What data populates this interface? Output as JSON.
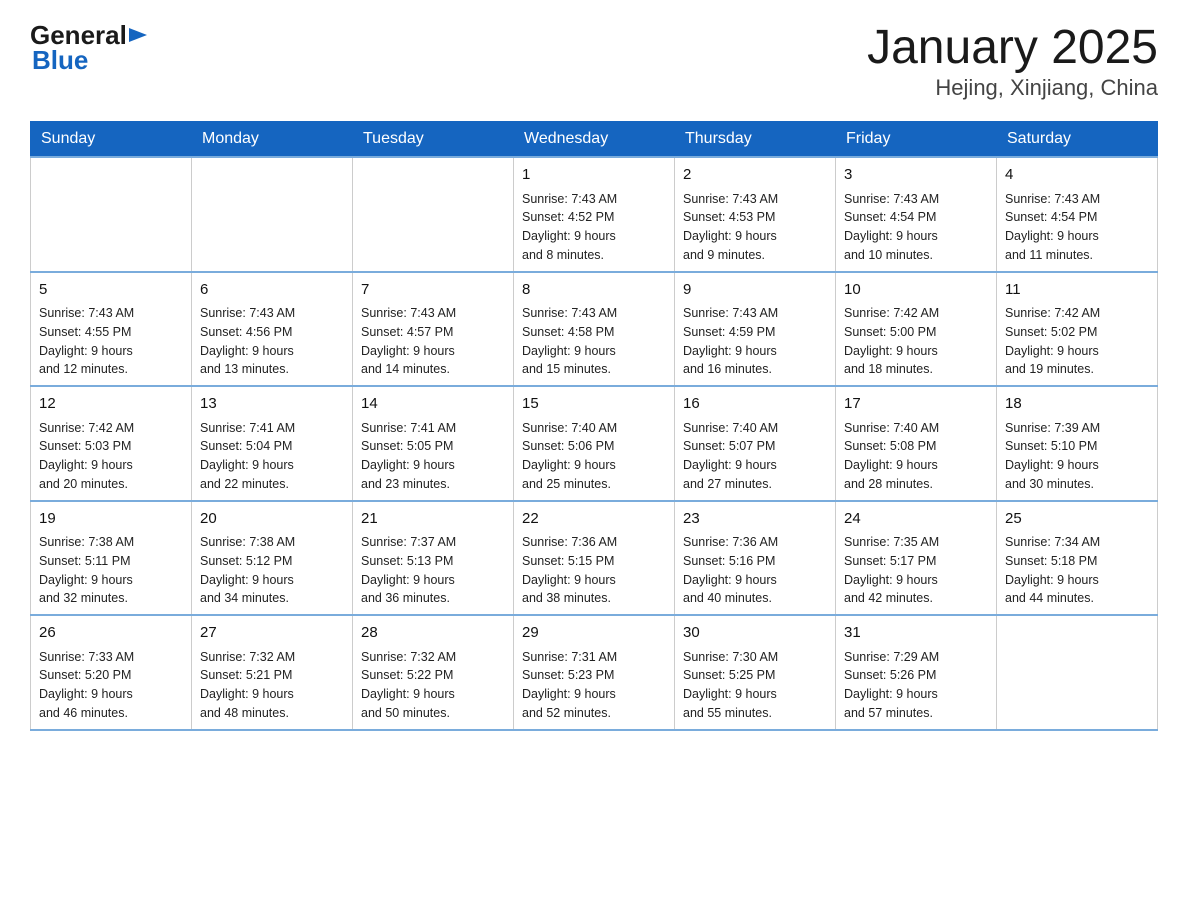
{
  "header": {
    "logo": {
      "general": "General",
      "blue": "Blue"
    },
    "title": "January 2025",
    "subtitle": "Hejing, Xinjiang, China"
  },
  "calendar": {
    "weekdays": [
      "Sunday",
      "Monday",
      "Tuesday",
      "Wednesday",
      "Thursday",
      "Friday",
      "Saturday"
    ],
    "weeks": [
      [
        {
          "day": "",
          "info": ""
        },
        {
          "day": "",
          "info": ""
        },
        {
          "day": "",
          "info": ""
        },
        {
          "day": "1",
          "info": "Sunrise: 7:43 AM\nSunset: 4:52 PM\nDaylight: 9 hours\nand 8 minutes."
        },
        {
          "day": "2",
          "info": "Sunrise: 7:43 AM\nSunset: 4:53 PM\nDaylight: 9 hours\nand 9 minutes."
        },
        {
          "day": "3",
          "info": "Sunrise: 7:43 AM\nSunset: 4:54 PM\nDaylight: 9 hours\nand 10 minutes."
        },
        {
          "day": "4",
          "info": "Sunrise: 7:43 AM\nSunset: 4:54 PM\nDaylight: 9 hours\nand 11 minutes."
        }
      ],
      [
        {
          "day": "5",
          "info": "Sunrise: 7:43 AM\nSunset: 4:55 PM\nDaylight: 9 hours\nand 12 minutes."
        },
        {
          "day": "6",
          "info": "Sunrise: 7:43 AM\nSunset: 4:56 PM\nDaylight: 9 hours\nand 13 minutes."
        },
        {
          "day": "7",
          "info": "Sunrise: 7:43 AM\nSunset: 4:57 PM\nDaylight: 9 hours\nand 14 minutes."
        },
        {
          "day": "8",
          "info": "Sunrise: 7:43 AM\nSunset: 4:58 PM\nDaylight: 9 hours\nand 15 minutes."
        },
        {
          "day": "9",
          "info": "Sunrise: 7:43 AM\nSunset: 4:59 PM\nDaylight: 9 hours\nand 16 minutes."
        },
        {
          "day": "10",
          "info": "Sunrise: 7:42 AM\nSunset: 5:00 PM\nDaylight: 9 hours\nand 18 minutes."
        },
        {
          "day": "11",
          "info": "Sunrise: 7:42 AM\nSunset: 5:02 PM\nDaylight: 9 hours\nand 19 minutes."
        }
      ],
      [
        {
          "day": "12",
          "info": "Sunrise: 7:42 AM\nSunset: 5:03 PM\nDaylight: 9 hours\nand 20 minutes."
        },
        {
          "day": "13",
          "info": "Sunrise: 7:41 AM\nSunset: 5:04 PM\nDaylight: 9 hours\nand 22 minutes."
        },
        {
          "day": "14",
          "info": "Sunrise: 7:41 AM\nSunset: 5:05 PM\nDaylight: 9 hours\nand 23 minutes."
        },
        {
          "day": "15",
          "info": "Sunrise: 7:40 AM\nSunset: 5:06 PM\nDaylight: 9 hours\nand 25 minutes."
        },
        {
          "day": "16",
          "info": "Sunrise: 7:40 AM\nSunset: 5:07 PM\nDaylight: 9 hours\nand 27 minutes."
        },
        {
          "day": "17",
          "info": "Sunrise: 7:40 AM\nSunset: 5:08 PM\nDaylight: 9 hours\nand 28 minutes."
        },
        {
          "day": "18",
          "info": "Sunrise: 7:39 AM\nSunset: 5:10 PM\nDaylight: 9 hours\nand 30 minutes."
        }
      ],
      [
        {
          "day": "19",
          "info": "Sunrise: 7:38 AM\nSunset: 5:11 PM\nDaylight: 9 hours\nand 32 minutes."
        },
        {
          "day": "20",
          "info": "Sunrise: 7:38 AM\nSunset: 5:12 PM\nDaylight: 9 hours\nand 34 minutes."
        },
        {
          "day": "21",
          "info": "Sunrise: 7:37 AM\nSunset: 5:13 PM\nDaylight: 9 hours\nand 36 minutes."
        },
        {
          "day": "22",
          "info": "Sunrise: 7:36 AM\nSunset: 5:15 PM\nDaylight: 9 hours\nand 38 minutes."
        },
        {
          "day": "23",
          "info": "Sunrise: 7:36 AM\nSunset: 5:16 PM\nDaylight: 9 hours\nand 40 minutes."
        },
        {
          "day": "24",
          "info": "Sunrise: 7:35 AM\nSunset: 5:17 PM\nDaylight: 9 hours\nand 42 minutes."
        },
        {
          "day": "25",
          "info": "Sunrise: 7:34 AM\nSunset: 5:18 PM\nDaylight: 9 hours\nand 44 minutes."
        }
      ],
      [
        {
          "day": "26",
          "info": "Sunrise: 7:33 AM\nSunset: 5:20 PM\nDaylight: 9 hours\nand 46 minutes."
        },
        {
          "day": "27",
          "info": "Sunrise: 7:32 AM\nSunset: 5:21 PM\nDaylight: 9 hours\nand 48 minutes."
        },
        {
          "day": "28",
          "info": "Sunrise: 7:32 AM\nSunset: 5:22 PM\nDaylight: 9 hours\nand 50 minutes."
        },
        {
          "day": "29",
          "info": "Sunrise: 7:31 AM\nSunset: 5:23 PM\nDaylight: 9 hours\nand 52 minutes."
        },
        {
          "day": "30",
          "info": "Sunrise: 7:30 AM\nSunset: 5:25 PM\nDaylight: 9 hours\nand 55 minutes."
        },
        {
          "day": "31",
          "info": "Sunrise: 7:29 AM\nSunset: 5:26 PM\nDaylight: 9 hours\nand 57 minutes."
        },
        {
          "day": "",
          "info": ""
        }
      ]
    ]
  }
}
